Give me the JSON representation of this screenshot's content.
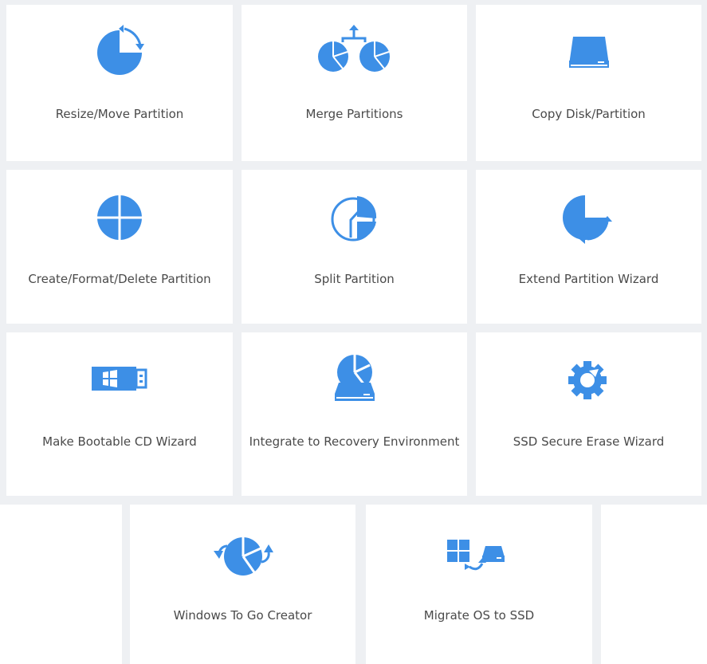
{
  "accent_color": "#3d8fe6",
  "tools": [
    {
      "label": "Resize/Move Partition",
      "icon": "resize-move-partition-icon"
    },
    {
      "label": "Merge Partitions",
      "icon": "merge-partitions-icon"
    },
    {
      "label": "Copy Disk/Partition",
      "icon": "copy-disk-icon"
    },
    {
      "label": "Create/Format/Delete Partition",
      "icon": "pie-partition-icon"
    },
    {
      "label": "Split Partition",
      "icon": "split-partition-icon"
    },
    {
      "label": "Extend Partition Wizard",
      "icon": "extend-partition-icon"
    },
    {
      "label": "Make Bootable CD Wizard",
      "icon": "usb-drive-icon"
    },
    {
      "label": "Integrate to Recovery Environment",
      "icon": "recovery-disk-icon"
    },
    {
      "label": "SSD Secure Erase Wizard",
      "icon": "gear-refresh-icon"
    },
    {
      "label": "Windows To Go Creator",
      "icon": "windows-to-go-icon"
    },
    {
      "label": "Migrate OS to SSD",
      "icon": "migrate-os-icon"
    }
  ]
}
